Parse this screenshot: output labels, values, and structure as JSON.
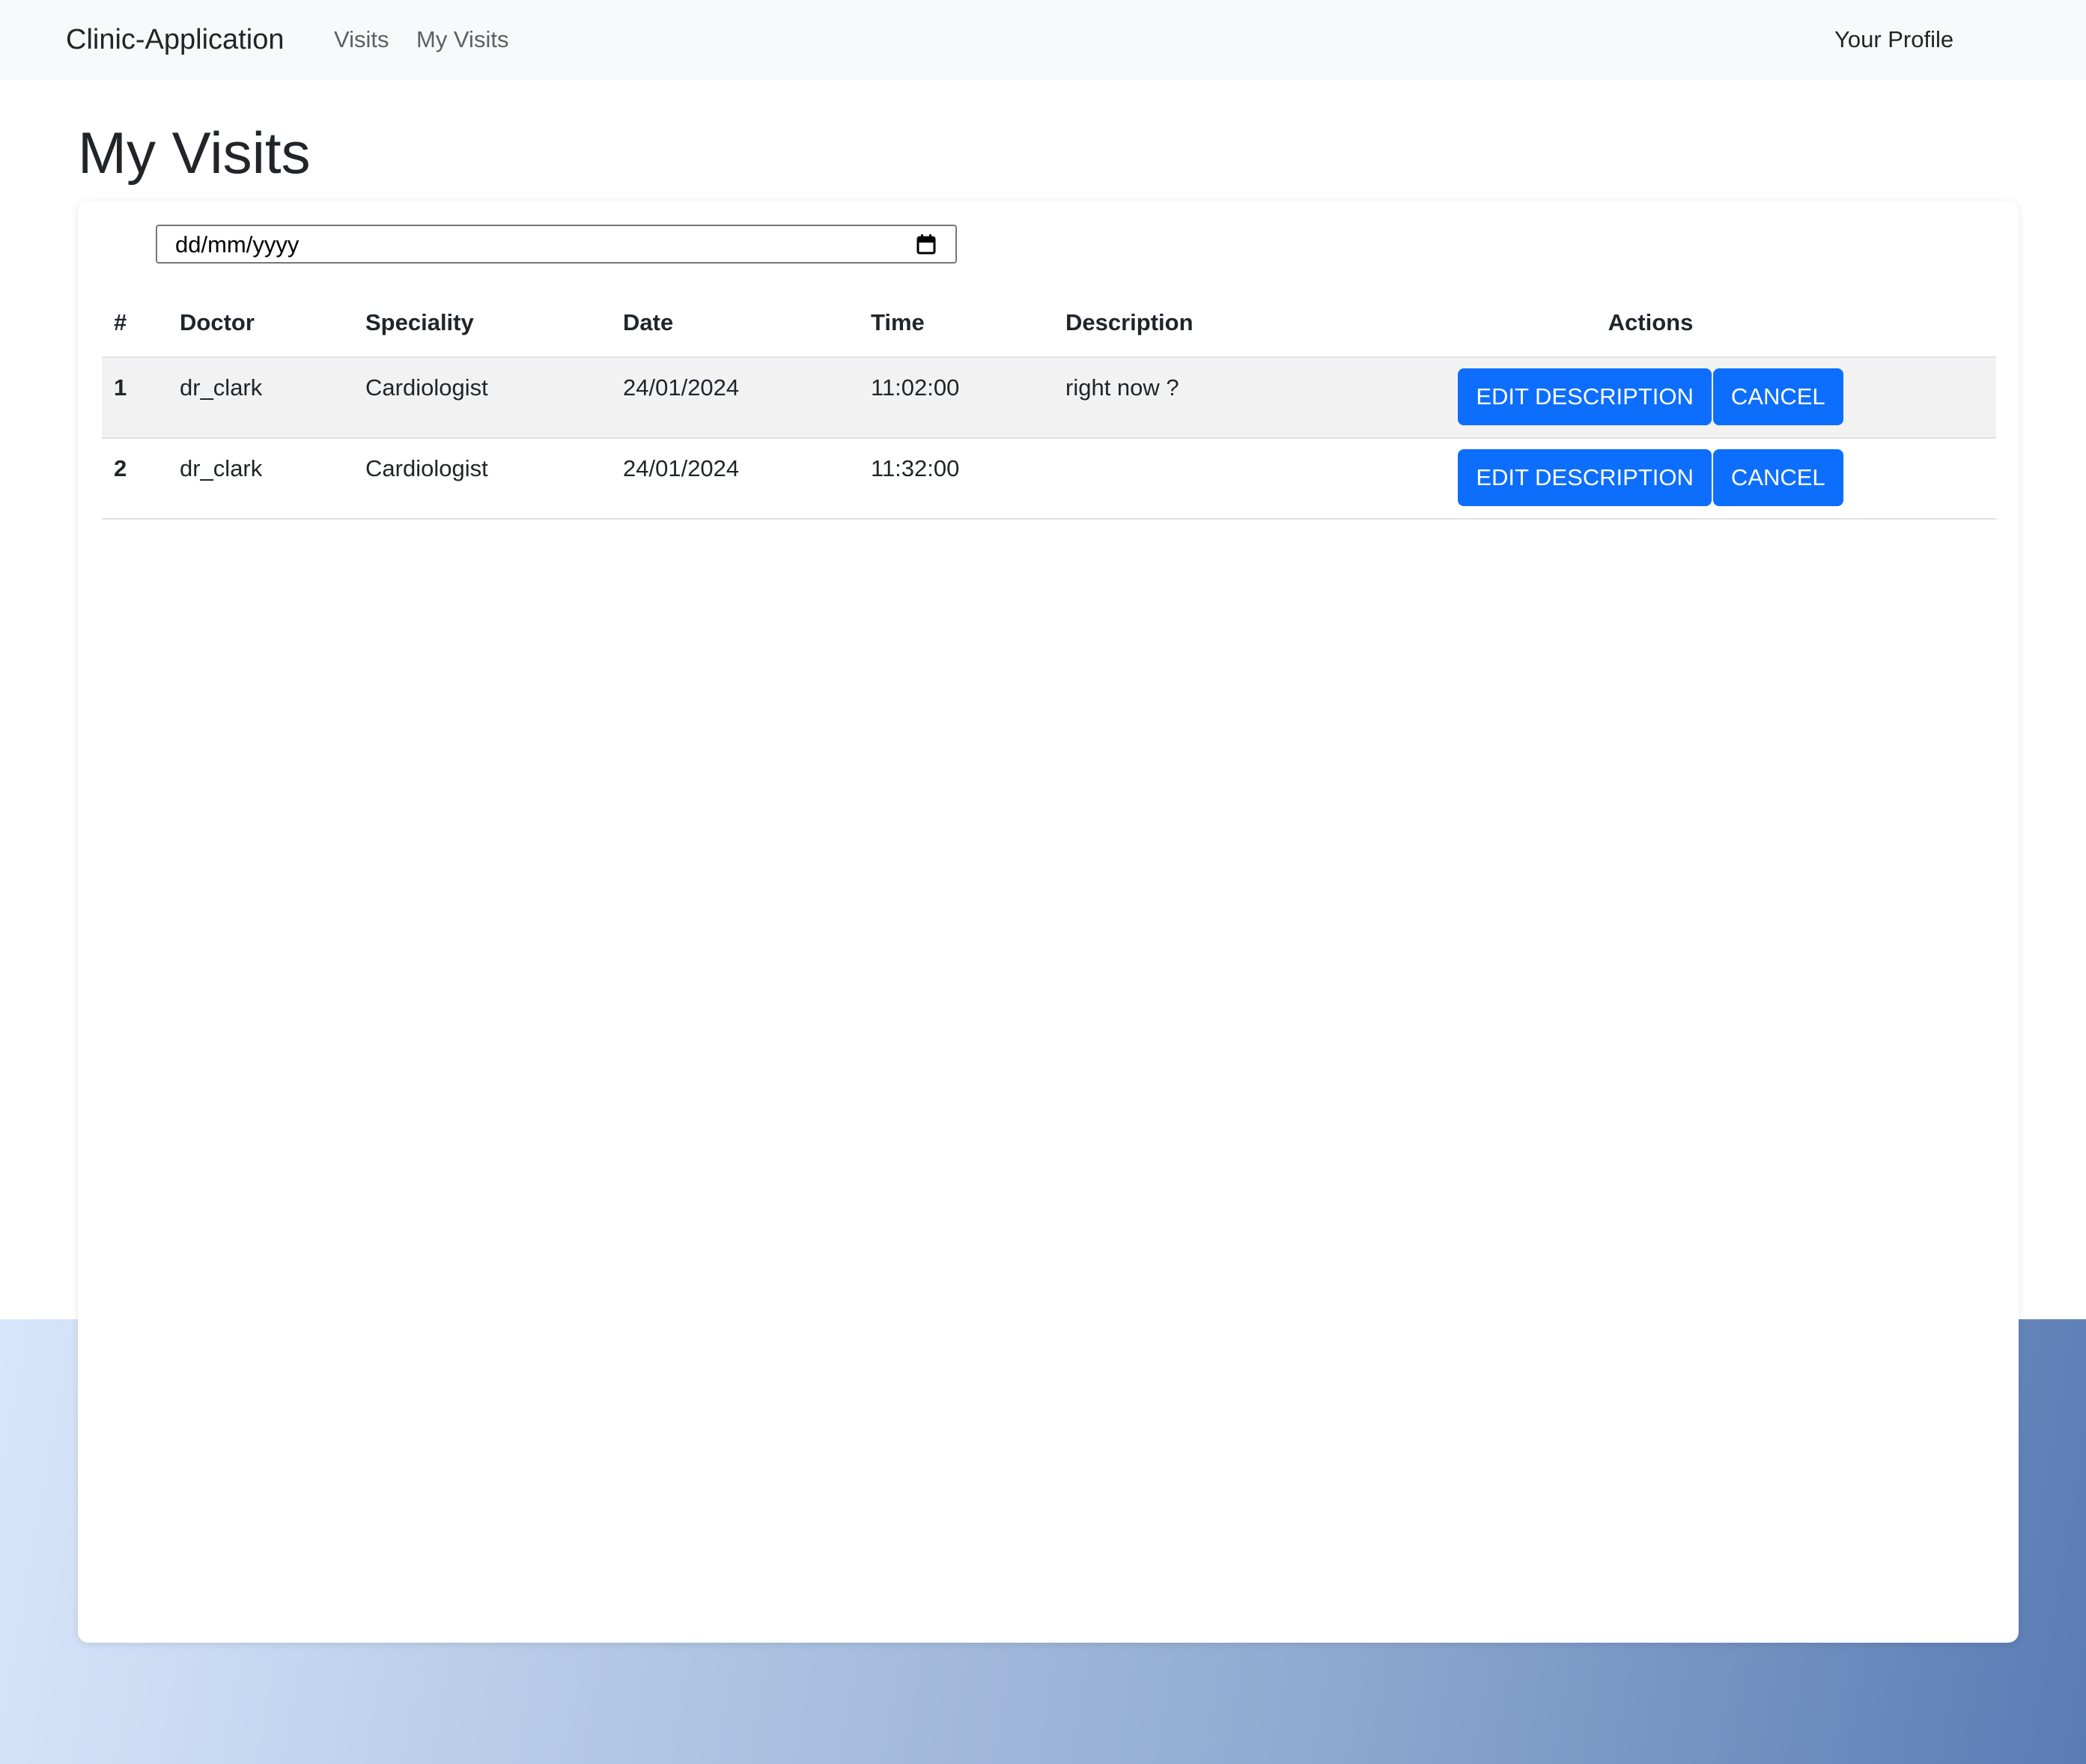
{
  "navbar": {
    "brand": "Clinic-Application",
    "links": [
      {
        "label": "Visits"
      },
      {
        "label": "My Visits"
      }
    ],
    "profile_label": "Your Profile"
  },
  "page": {
    "title": "My Visits"
  },
  "filter": {
    "date_placeholder": "dd/mm/yyyy",
    "date_value": ""
  },
  "table": {
    "headers": [
      "#",
      "Doctor",
      "Speciality",
      "Date",
      "Time",
      "Description",
      "Actions"
    ],
    "rows": [
      {
        "num": "1",
        "doctor": "dr_clark",
        "speciality": "Cardiologist",
        "date": "24/01/2024",
        "time": "11:02:00",
        "description": "right now ?",
        "edit_label": "EDIT DESCRIPTION",
        "cancel_label": "CANCEL"
      },
      {
        "num": "2",
        "doctor": "dr_clark",
        "speciality": "Cardiologist",
        "date": "24/01/2024",
        "time": "11:32:00",
        "description": "",
        "edit_label": "EDIT DESCRIPTION",
        "cancel_label": "CANCEL"
      }
    ]
  },
  "colors": {
    "primary": "#0d6efd",
    "navbar_bg": "#f8f9fa",
    "stripe": "#f2f2f2"
  },
  "icons": {
    "date_picker": "calendar-icon"
  }
}
